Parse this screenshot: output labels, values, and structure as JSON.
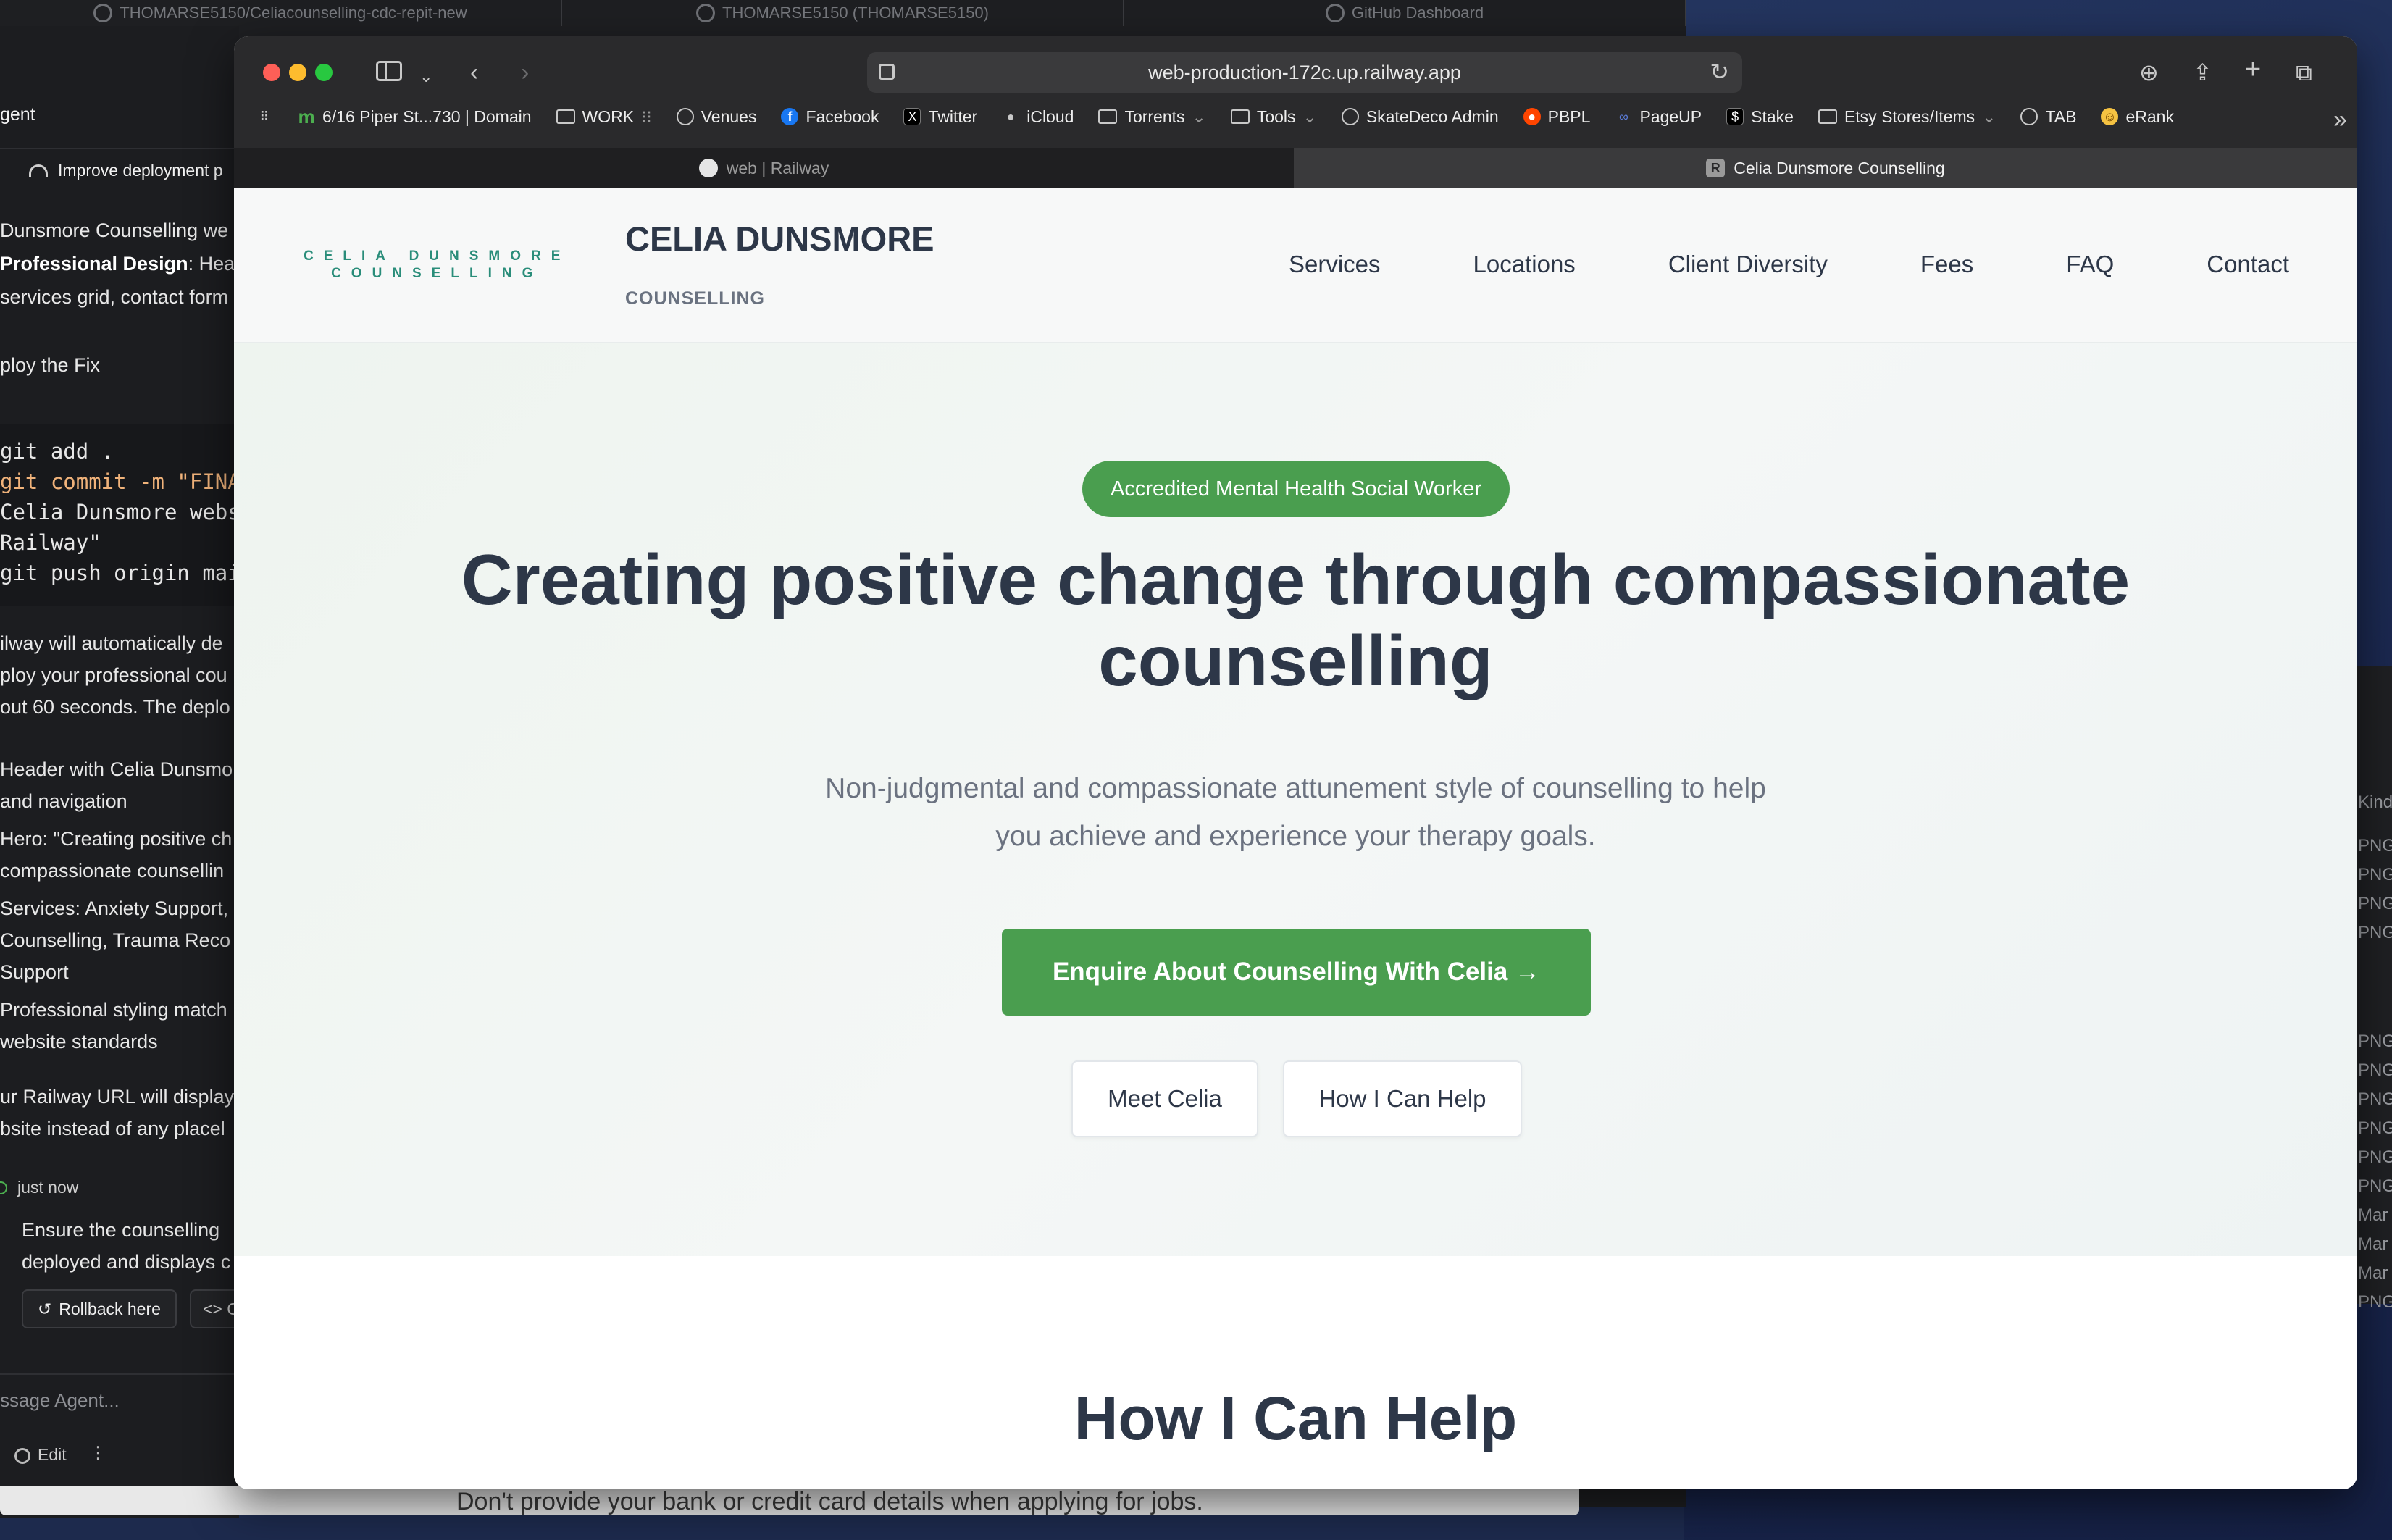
{
  "background_tabs": [
    {
      "label": "THOMARSE5150/Celiacounselling-cdc-repit-new"
    },
    {
      "label": "THOMARSE5150 (THOMARSE5150)"
    },
    {
      "label": "GitHub Dashboard"
    }
  ],
  "agent": {
    "title": "gent",
    "task": "Improve deployment p",
    "line1": "Dunsmore Counselling we",
    "pd_label": "Professional Design",
    "pd_rest": ": Head",
    "line3": "services grid, contact form",
    "deploy": "ploy the Fix",
    "code": [
      "git add .",
      "git commit -m \"FINAL",
      "Celia Dunsmore websi",
      "Railway\"",
      "git push origin main"
    ],
    "para1": [
      "ilway will automatically de",
      "ploy your professional cou",
      "out 60 seconds. The deplo"
    ],
    "bullets": [
      "Header with Celia Dunsmo",
      "and navigation",
      "Hero: \"Creating positive ch",
      "compassionate counsellin",
      "Services: Anxiety Support,",
      "Counselling, Trauma Reco",
      "Support",
      "Professional styling match",
      "website standards"
    ],
    "para2": [
      "ur Railway URL will display",
      "bsite instead of any placel"
    ],
    "just_now": "just now",
    "ensure": [
      "Ensure the counselling",
      "deployed and displays c"
    ],
    "rollback_label": "Rollback here",
    "code_label": "<> C",
    "message_placeholder": "ssage Agent...",
    "edit_label": "Edit"
  },
  "underneath_text": "Don't provide your bank or credit card details when applying for jobs.",
  "file_kinds": [
    "Kind",
    "PNG",
    "PNG",
    "PNG",
    "PNG",
    "PNG",
    "PNG",
    "PNG",
    "PNG",
    "PNG",
    "PNG",
    "Mar",
    "Mar",
    "Mar",
    "PNG"
  ],
  "browser": {
    "url": "web-production-172c.up.railway.app",
    "bookmarks": [
      {
        "label": "6/16 Piper St...730 | Domain",
        "icon": "m-icon"
      },
      {
        "label": "WORK",
        "icon": "folder-icon"
      },
      {
        "label": "Venues",
        "icon": "globe-icon"
      },
      {
        "label": "Facebook",
        "icon": "facebook-icon"
      },
      {
        "label": "Twitter",
        "icon": "x-icon"
      },
      {
        "label": "iCloud",
        "icon": "apple-icon"
      },
      {
        "label": "Torrents",
        "icon": "folder-icon"
      },
      {
        "label": "Tools",
        "icon": "folder-icon"
      },
      {
        "label": "SkateDeco Admin",
        "icon": "globe-icon"
      },
      {
        "label": "PBPL",
        "icon": "reddit-icon"
      },
      {
        "label": "PageUP",
        "icon": "meta-icon"
      },
      {
        "label": "Stake",
        "icon": "stake-icon"
      },
      {
        "label": "Etsy Stores/Items",
        "icon": "folder-icon"
      },
      {
        "label": "TAB",
        "icon": "globe-icon"
      },
      {
        "label": "eRank",
        "icon": "emoji-icon"
      }
    ],
    "tabs": [
      {
        "label": "web | Railway"
      },
      {
        "label": "Celia Dunsmore Counselling"
      }
    ]
  },
  "site": {
    "logo_line1": "CELIA DUNSMORE",
    "logo_line2": "COUNSELLING",
    "name": "CELIA DUNSMORE",
    "sub": "COUNSELLING",
    "nav": [
      "Services",
      "Locations",
      "Client Diversity",
      "Fees",
      "FAQ",
      "Contact"
    ],
    "badge": "Accredited Mental Health Social Worker",
    "hero_title": "Creating positive change through compassionate counselling",
    "hero_sub": "Non-judgmental and compassionate attunement style of counselling to help you achieve and experience your therapy goals.",
    "cta": "Enquire About Counselling With Celia →",
    "btn_meet": "Meet Celia",
    "btn_help": "How I Can Help",
    "section_title": "How I Can Help"
  },
  "colors": {
    "accent_green": "#4a9e4f",
    "logo_teal": "#2a8d7a",
    "heading": "#2d3748"
  }
}
